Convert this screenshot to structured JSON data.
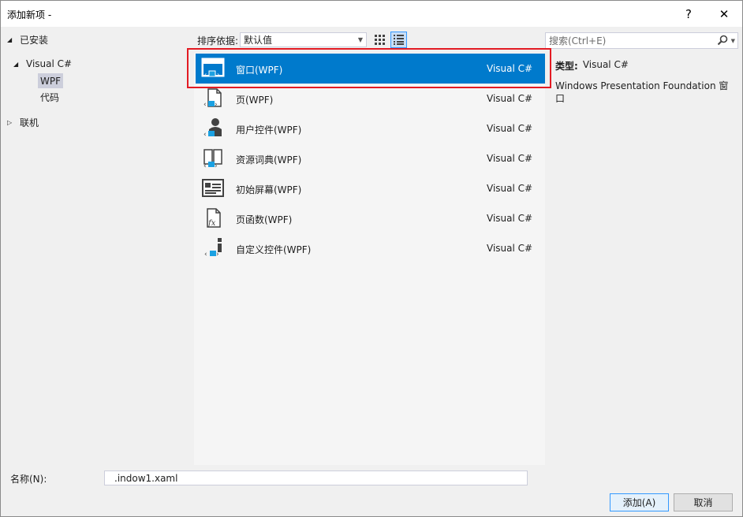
{
  "window": {
    "title": "添加新项 -",
    "help_glyph": "?",
    "close_glyph": "✕"
  },
  "tree": {
    "installed": "已安装",
    "visual_csharp": "Visual C#",
    "wpf": "WPF",
    "code": "代码",
    "online": "联机"
  },
  "toolbar": {
    "sort_label": "排序依据:",
    "sort_value": "默认值"
  },
  "search": {
    "placeholder": "搜索(Ctrl+E)"
  },
  "templates": [
    {
      "name": "窗口(WPF)",
      "type": "Visual C#",
      "icon": "wpf-window-icon",
      "selected": true
    },
    {
      "name": "页(WPF)",
      "type": "Visual C#",
      "icon": "wpf-page-icon",
      "selected": false
    },
    {
      "name": "用户控件(WPF)",
      "type": "Visual C#",
      "icon": "wpf-user-control-icon",
      "selected": false
    },
    {
      "name": "资源词典(WPF)",
      "type": "Visual C#",
      "icon": "wpf-resource-dictionary-icon",
      "selected": false
    },
    {
      "name": "初始屏幕(WPF)",
      "type": "Visual C#",
      "icon": "wpf-splash-screen-icon",
      "selected": false
    },
    {
      "name": "页函数(WPF)",
      "type": "Visual C#",
      "icon": "wpf-page-function-icon",
      "selected": false
    },
    {
      "name": "自定义控件(WPF)",
      "type": "Visual C#",
      "icon": "wpf-custom-control-icon",
      "selected": false
    }
  ],
  "details": {
    "type_label": "类型:",
    "type_value": "Visual C#",
    "description": "Windows Presentation Foundation 窗口"
  },
  "bottom": {
    "name_label": "名称(N):",
    "name_value": ".indow1.xaml",
    "add_button": "添加(A)",
    "cancel_button": "取消"
  },
  "colors": {
    "selection": "#007acc",
    "highlight_border": "#e31b23",
    "icon_dark": "#424242",
    "icon_accent": "#1ba1e2"
  }
}
